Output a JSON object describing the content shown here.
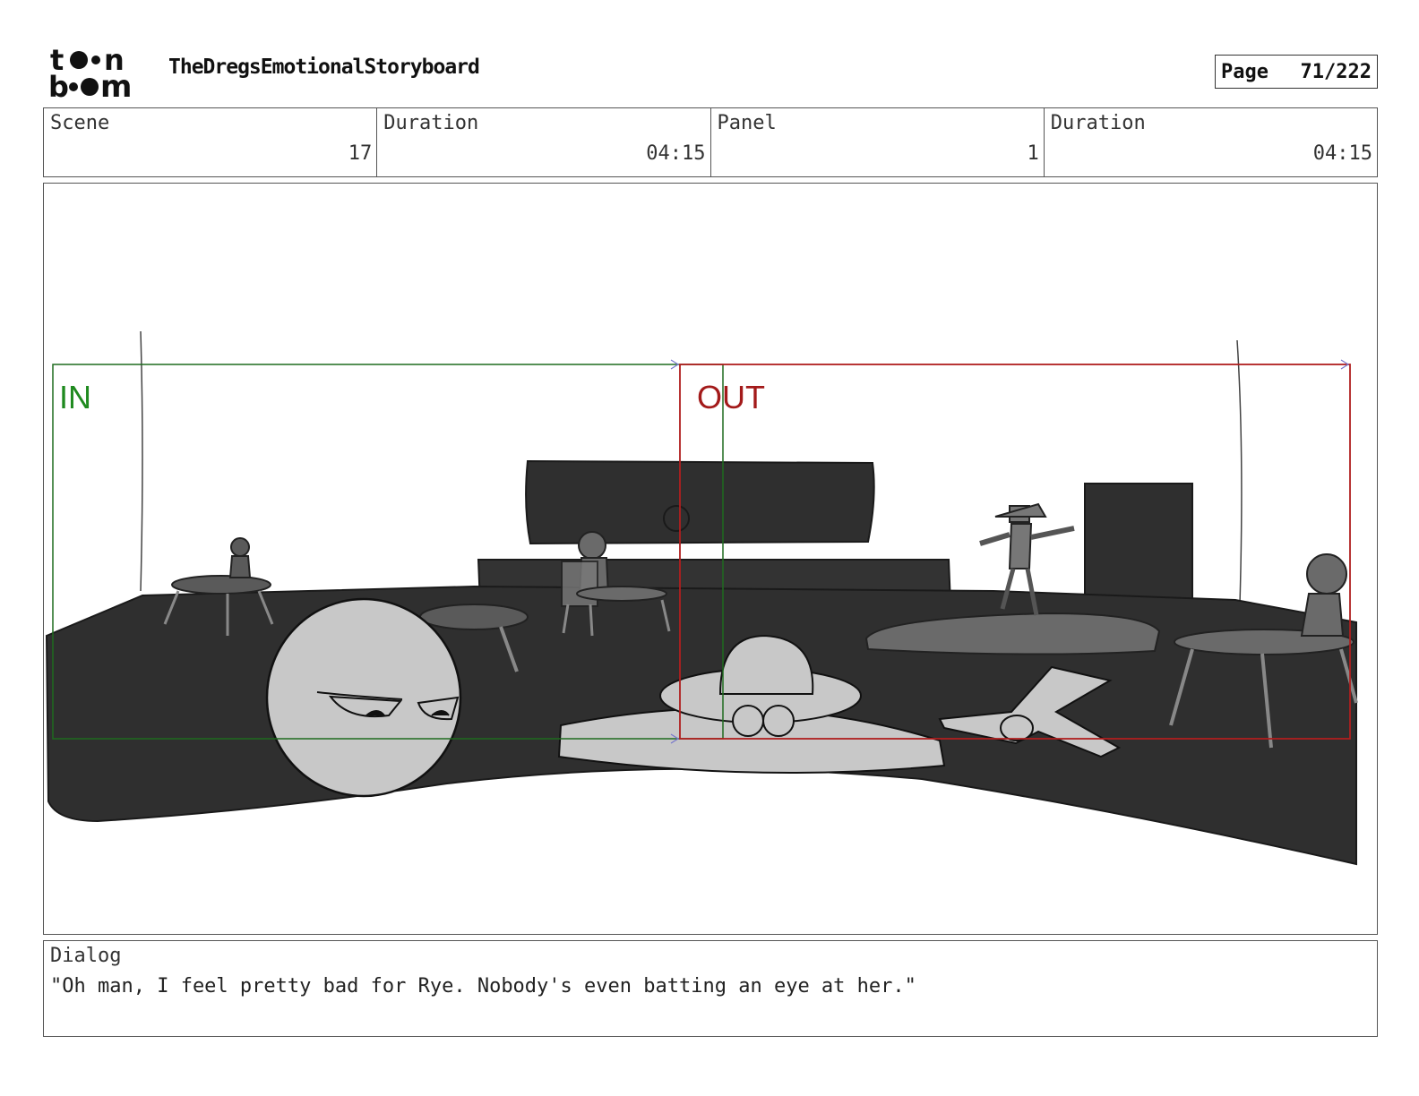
{
  "header": {
    "logo_text": "toon boom",
    "project_title": "TheDregsEmotionalStoryboard",
    "page_label": "Page",
    "page_number": "71/222"
  },
  "info": {
    "scene_label": "Scene",
    "scene_value": "17",
    "scene_duration_label": "Duration",
    "scene_duration_value": "04:15",
    "panel_label": "Panel",
    "panel_value": "1",
    "panel_duration_label": "Duration",
    "panel_duration_value": "04:15"
  },
  "panel": {
    "camera_in_label": "IN",
    "camera_out_label": "OUT",
    "colors": {
      "camera_in": "#1f8a1f",
      "camera_out": "#a31a1a",
      "floor": "#2f2f2f",
      "furniture": "#5a5a5a",
      "character": "#c8c8c8"
    }
  },
  "dialog": {
    "label": "Dialog",
    "text": "\"Oh man, I feel pretty bad for Rye. Nobody's even batting an eye at her.\""
  }
}
